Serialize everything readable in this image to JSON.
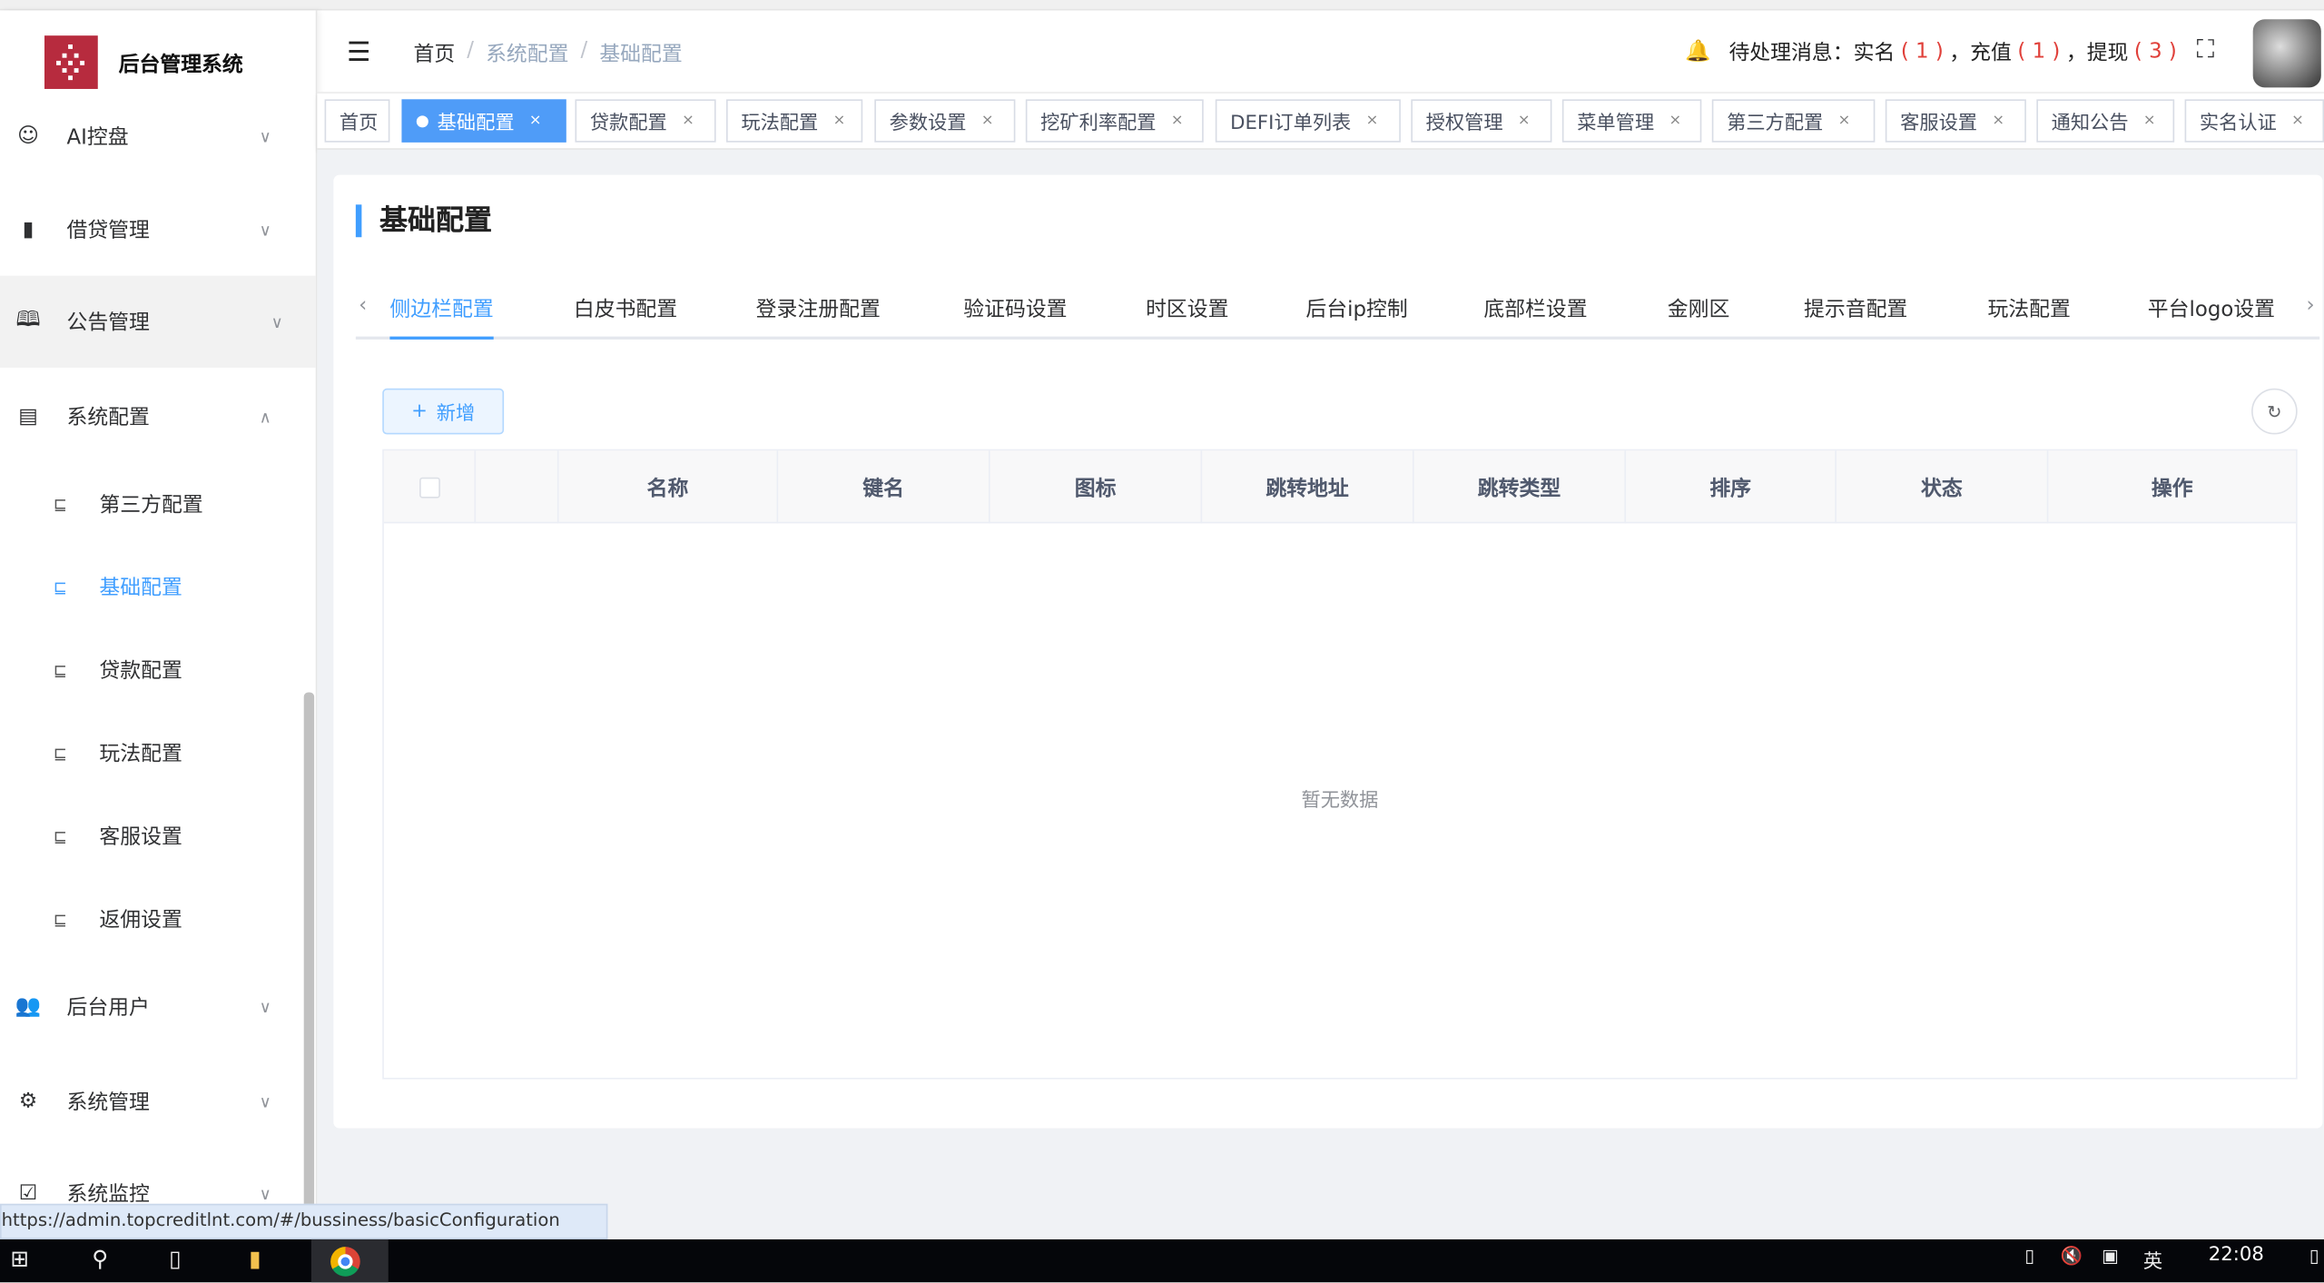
{
  "app": {
    "title": "后台管理系统"
  },
  "sidebar": {
    "items": [
      {
        "label": "AI控盘",
        "icon": "robot-icon"
      },
      {
        "label": "借贷管理",
        "icon": "book-icon"
      },
      {
        "label": "公告管理",
        "icon": "open-book-icon"
      },
      {
        "label": "系统配置",
        "icon": "document-icon"
      },
      {
        "label": "后台用户",
        "icon": "users-icon"
      },
      {
        "label": "系统管理",
        "icon": "gear-icon"
      },
      {
        "label": "系统监控",
        "icon": "monitor-icon"
      }
    ],
    "sub_items": [
      "第三方配置",
      "基础配置",
      "贷款配置",
      "玩法配置",
      "客服设置",
      "返佣设置"
    ]
  },
  "header": {
    "breadcrumb": [
      "首页",
      "系统配置",
      "基础配置"
    ],
    "notice": {
      "prefix": "待处理消息：实名",
      "realname": "( 1 )",
      "mid1": "，充值",
      "recharge": "( 1 )",
      "mid2": "，提现",
      "withdraw": "( 3 )"
    }
  },
  "tags": [
    "首页",
    "基础配置",
    "贷款配置",
    "玩法配置",
    "参数设置",
    "挖矿利率配置",
    "DEFI订单列表",
    "授权管理",
    "菜单管理",
    "第三方配置",
    "客服设置",
    "通知公告",
    "实名认证"
  ],
  "page": {
    "title": "基础配置",
    "subtabs": [
      "侧边栏配置",
      "白皮书配置",
      "登录注册配置",
      "验证码设置",
      "时区设置",
      "后台ip控制",
      "底部栏设置",
      "金刚区",
      "提示音配置",
      "玩法配置",
      "平台logo设置"
    ],
    "add_label": "新增",
    "columns": [
      "名称",
      "键名",
      "图标",
      "跳转地址",
      "跳转类型",
      "排序",
      "状态",
      "操作"
    ],
    "empty": "暂无数据"
  },
  "status_url": "https://admin.topcreditlnt.com/#/bussiness/basicConfiguration",
  "taskbar": {
    "time": "22:08",
    "ime": "英"
  },
  "colors": {
    "accent": "#409eff",
    "brand": "#b72b3e",
    "alert": "#e0403a"
  }
}
